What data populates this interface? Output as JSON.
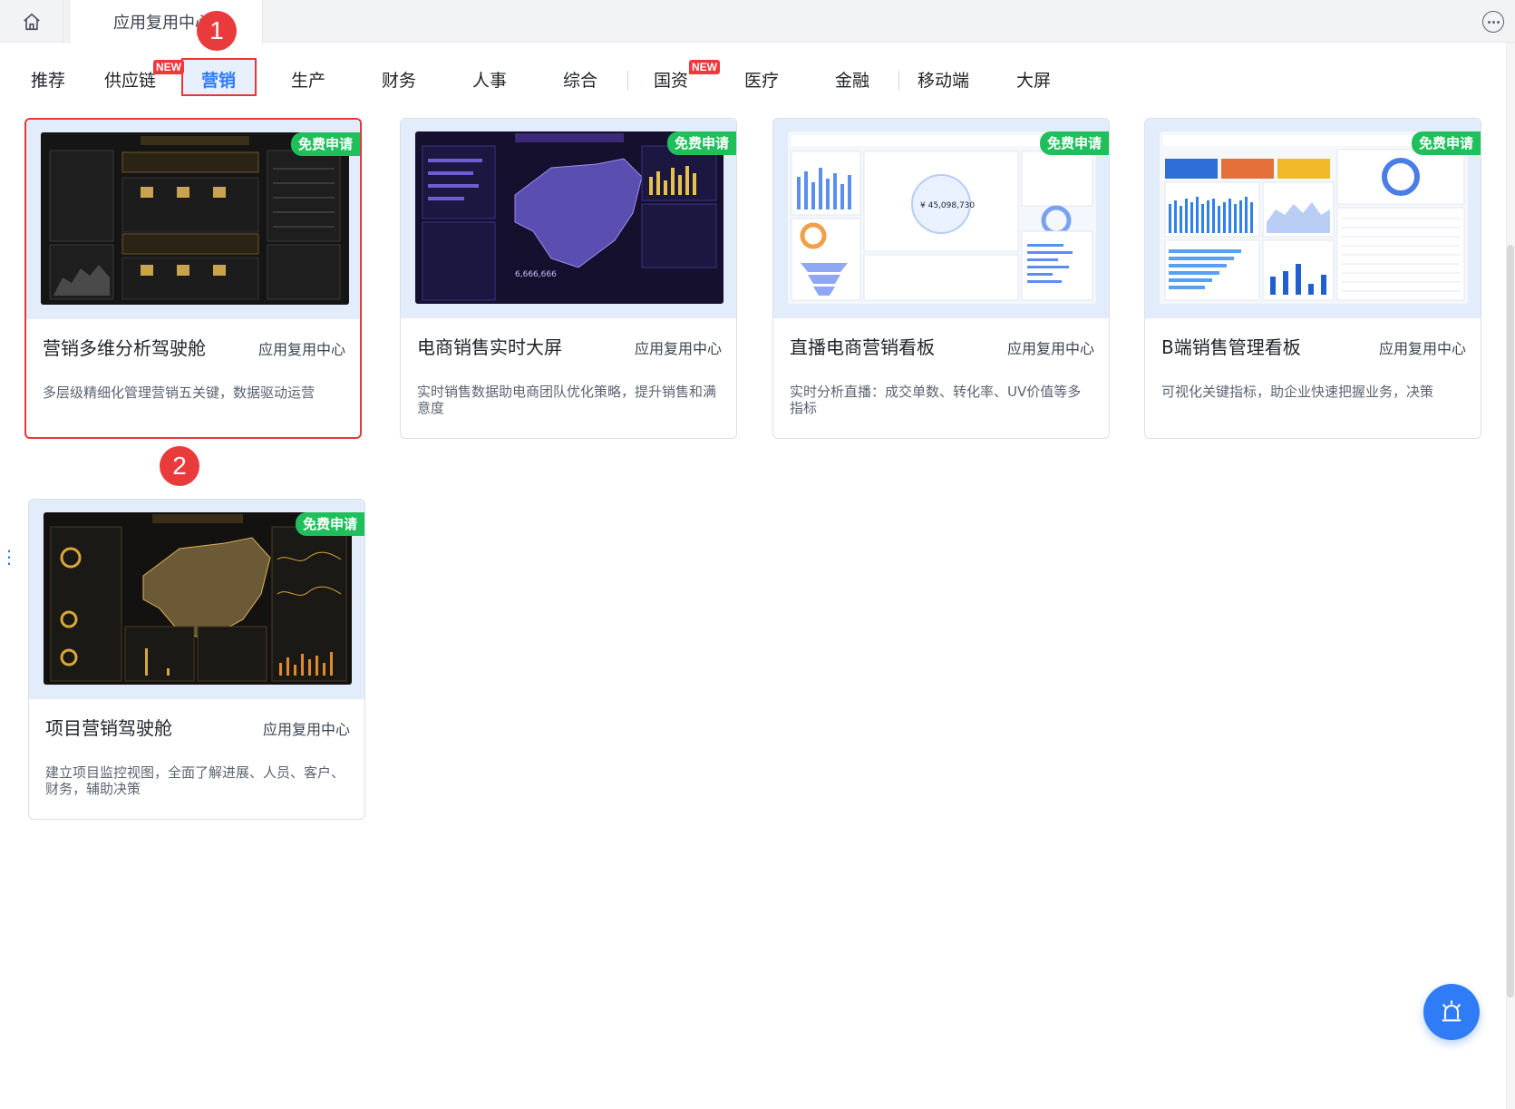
{
  "topbar": {
    "tab_title": "应用复用中心"
  },
  "categories": [
    {
      "label": "推荐"
    },
    {
      "label": "供应链",
      "badge": "NEW"
    },
    {
      "label": "营销",
      "active": true
    },
    {
      "label": "生产"
    },
    {
      "label": "财务"
    },
    {
      "label": "人事"
    },
    {
      "label": "综合"
    },
    {
      "label": "国资",
      "badge": "NEW"
    },
    {
      "label": "医疗"
    },
    {
      "label": "金融"
    },
    {
      "label": "移动端"
    },
    {
      "label": "大屏"
    }
  ],
  "markers": [
    "1",
    "2"
  ],
  "cards": [
    {
      "title": "营销多维分析驾驶舱",
      "source": "应用复用中心",
      "badge": "免费申请",
      "desc": "多层级精细化管理营销五关键，数据驱动运营",
      "selected": true
    },
    {
      "title": "电商销售实时大屏",
      "source": "应用复用中心",
      "badge": "免费申请",
      "desc": "实时销售数据助电商团队优化策略，提升销售和满意度"
    },
    {
      "title": "直播电商营销看板",
      "source": "应用复用中心",
      "badge": "免费申请",
      "desc": "实时分析直播：成交单数、转化率、UV价值等多指标"
    },
    {
      "title": "B端销售管理看板",
      "source": "应用复用中心",
      "badge": "免费申请",
      "desc": "可视化关键指标，助企业快速把握业务，决策"
    },
    {
      "title": "项目营销驾驶舱",
      "source": "应用复用中心",
      "badge": "免费申请",
      "desc": "建立项目监控视图，全面了解进展、人员、客户、财务，辅助决策"
    }
  ],
  "icons": {
    "home": "home-icon",
    "more": "more-icon",
    "float": "alarm-bell-icon"
  },
  "colors": {
    "accent": "#2f7cf6",
    "badge_green": "#1fbf5b",
    "new_red": "#f0373c",
    "annotation_red": "#e53935"
  }
}
